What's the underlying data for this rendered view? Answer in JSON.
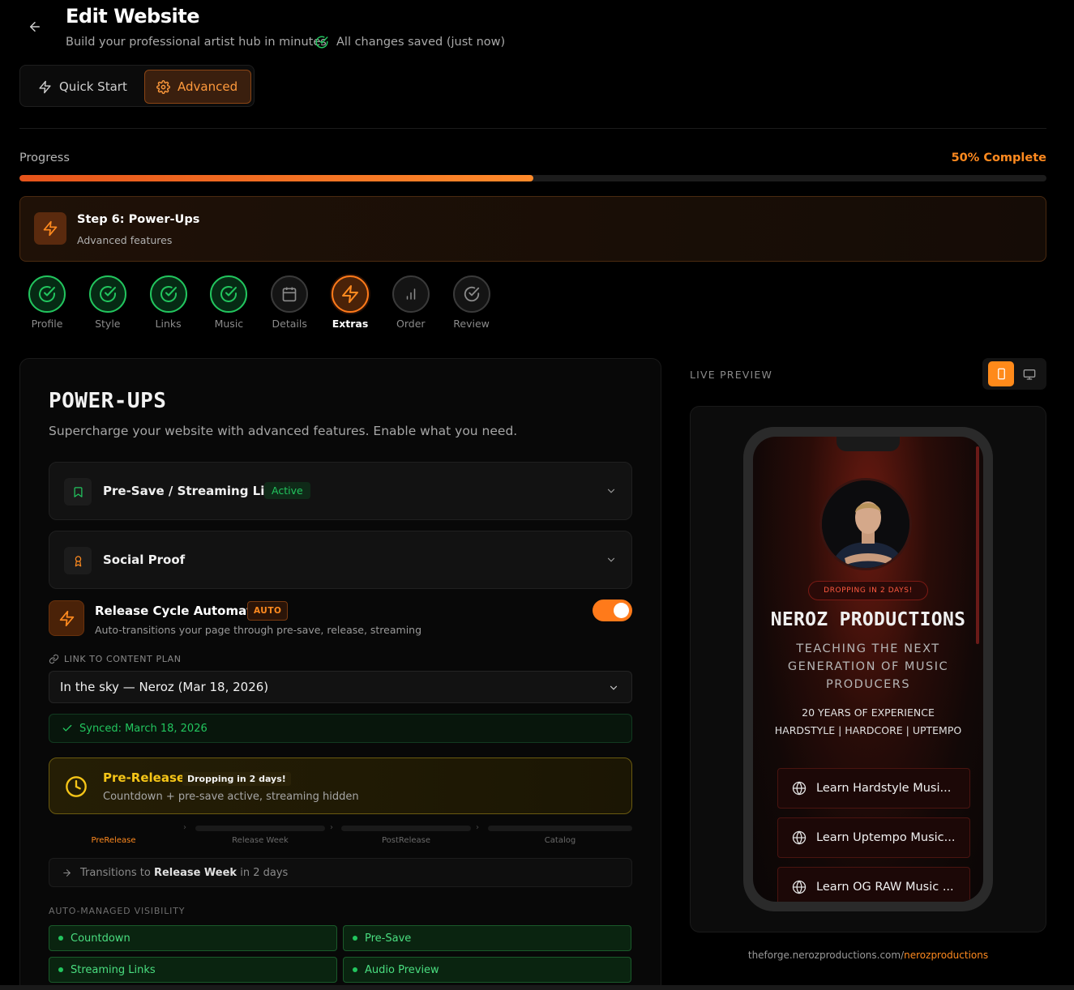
{
  "header": {
    "title": "Edit Website",
    "subtitle": "Build your professional artist hub in minutes",
    "saved_status": "All changes saved (just now)"
  },
  "mode": {
    "quick_label": "Quick Start",
    "advanced_label": "Advanced",
    "selected": "Advanced"
  },
  "progress": {
    "label": "Progress",
    "percent_label": "50% Complete",
    "value": 0.5
  },
  "current_step": {
    "title": "Step 6: Power-Ups",
    "subtitle": "Advanced features"
  },
  "steps": [
    {
      "label": "Profile",
      "state": "done"
    },
    {
      "label": "Style",
      "state": "done"
    },
    {
      "label": "Links",
      "state": "done"
    },
    {
      "label": "Music",
      "state": "done"
    },
    {
      "label": "Details",
      "state": "pending"
    },
    {
      "label": "Extras",
      "state": "active"
    },
    {
      "label": "Order",
      "state": "pending"
    },
    {
      "label": "Review",
      "state": "pending"
    }
  ],
  "powerups": {
    "title": "POWER-UPS",
    "subtitle": "Supercharge your website with advanced features. Enable what you need.",
    "accordions": [
      {
        "label": "Pre-Save / Streaming Links",
        "badge": "Active",
        "icon": "bookmark-icon"
      },
      {
        "label": "Social Proof",
        "badge": "",
        "icon": "award-icon"
      }
    ],
    "release_cycle": {
      "title": "Release Cycle Automation",
      "badge": "AUTO",
      "description": "Auto-transitions your page through pre-save, release, streaming",
      "enabled": true
    },
    "link_label": "LINK TO CONTENT PLAN",
    "selected_plan": "In the sky — Neroz (Mar 18, 2026)",
    "synced": "Synced: March 18, 2026",
    "phase": {
      "title": "Pre-Release",
      "badge": "Dropping in 2 days!",
      "description": "Countdown + pre-save active, streaming hidden"
    },
    "phases": [
      "PreRelease",
      "Release Week",
      "PostRelease",
      "Catalog"
    ],
    "transition": {
      "prefix": "Transitions to",
      "target": "Release Week",
      "suffix": "in 2 days"
    },
    "visibility_label": "AUTO-MANAGED VISIBILITY",
    "visibility": [
      "Countdown",
      "Pre-Save",
      "Streaming Links",
      "Audio Preview"
    ]
  },
  "preview": {
    "label": "LIVE PREVIEW",
    "device": "mobile",
    "pill": "DROPPING IN 2 DAYS!",
    "artist": "NEROZ PRODUCTIONS",
    "tagline": "TEACHING THE NEXT GENERATION OF MUSIC PRODUCERS",
    "bio_line1": "20 YEARS OF EXPERIENCE",
    "bio_line2": "HARDSTYLE | HARDCORE | UPTEMPO",
    "buttons": [
      "Learn Hardstyle Musi...",
      "Learn Uptempo Music...",
      "Learn OG RAW Music ..."
    ],
    "url_base": "theforge.nerozproductions.com/",
    "url_slug": "nerozproductions"
  },
  "colors": {
    "accent": "#ff7a1a",
    "success": "#22c55e",
    "warning": "#f5c518"
  }
}
